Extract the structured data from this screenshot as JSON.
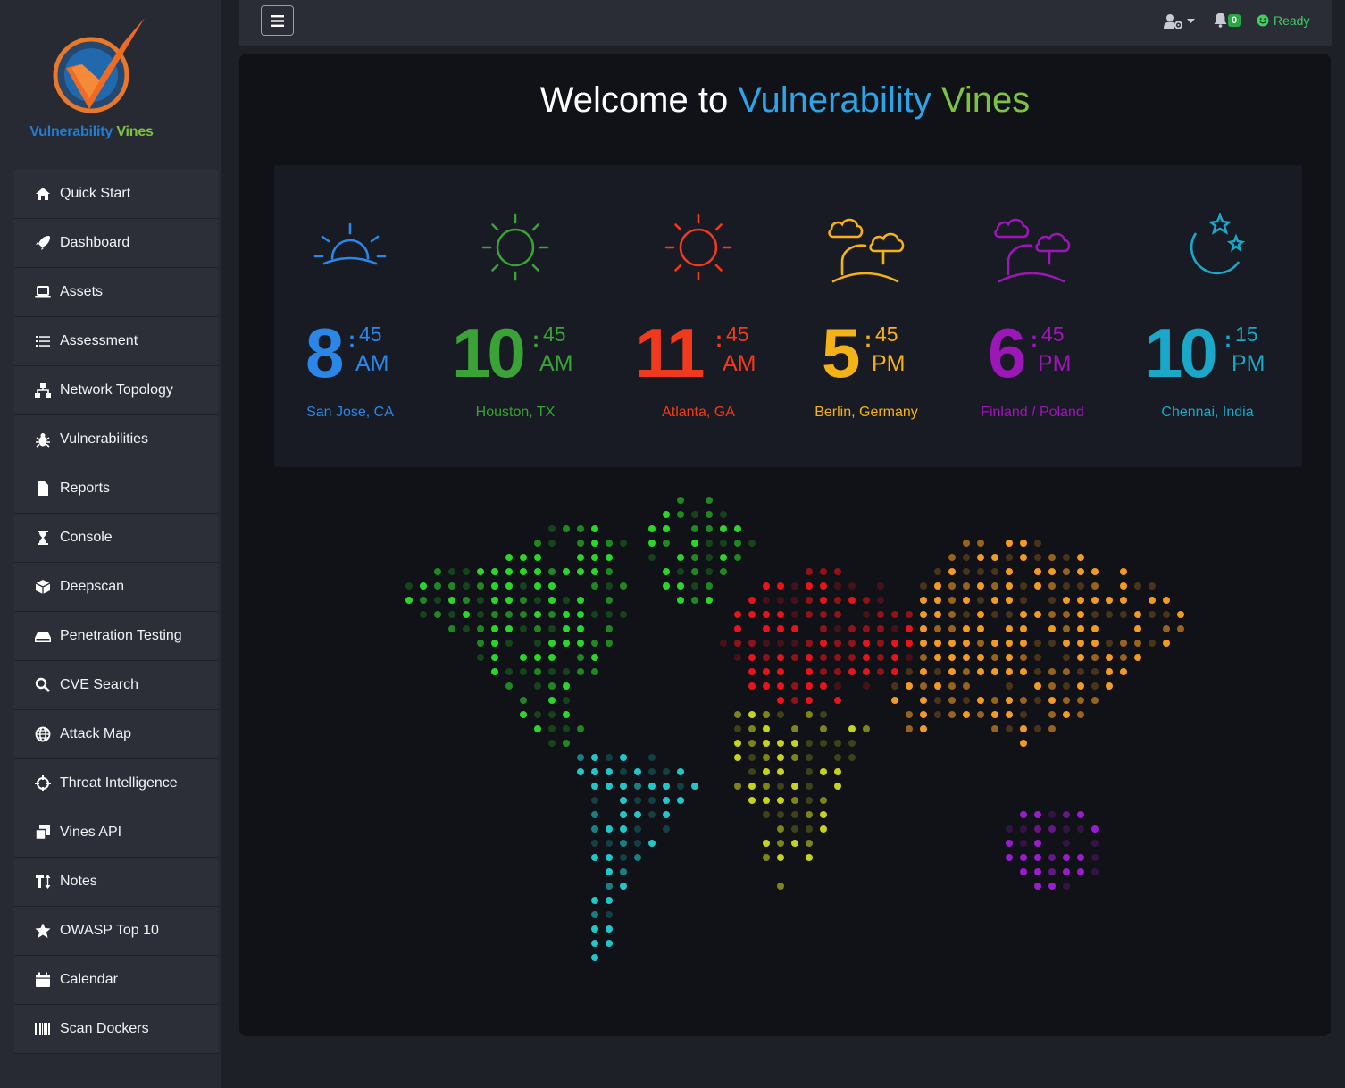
{
  "brand": {
    "name_part1": "Vulnerability",
    "name_part2": "Vines"
  },
  "sidebar": {
    "items": [
      {
        "label": "Quick Start",
        "icon": "home-icon"
      },
      {
        "label": "Dashboard",
        "icon": "rocket-icon"
      },
      {
        "label": "Assets",
        "icon": "laptop-icon"
      },
      {
        "label": "Assessment",
        "icon": "list-icon"
      },
      {
        "label": "Network Topology",
        "icon": "network-icon"
      },
      {
        "label": "Vulnerabilities",
        "icon": "bug-icon"
      },
      {
        "label": "Reports",
        "icon": "file-icon"
      },
      {
        "label": "Console",
        "icon": "hourglass-icon"
      },
      {
        "label": "Deepscan",
        "icon": "cube-icon"
      },
      {
        "label": "Penetration Testing",
        "icon": "hdd-icon"
      },
      {
        "label": "CVE Search",
        "icon": "search-icon"
      },
      {
        "label": "Attack Map",
        "icon": "globe-icon"
      },
      {
        "label": "Threat Intelligence",
        "icon": "crosshairs-icon"
      },
      {
        "label": "Vines API",
        "icon": "clone-icon"
      },
      {
        "label": "Notes",
        "icon": "text-height-icon"
      },
      {
        "label": "OWASP Top 10",
        "icon": "star-icon"
      },
      {
        "label": "Calendar",
        "icon": "calendar-icon"
      },
      {
        "label": "Scan Dockers",
        "icon": "barcode-icon"
      }
    ]
  },
  "topbar": {
    "notification_count": "0",
    "status": "Ready"
  },
  "welcome": {
    "prefix": "Welcome to",
    "part1": "Vulnerability",
    "part2": "Vines"
  },
  "clocks": [
    {
      "hour": "8",
      "minute": "45",
      "ampm": "AM",
      "city": "San Jose, CA",
      "color": "#2a87e8",
      "icon": "sunrise-icon"
    },
    {
      "hour": "10",
      "minute": "45",
      "ampm": "AM",
      "city": "Houston, TX",
      "color": "#3aa236",
      "icon": "sun-icon"
    },
    {
      "hour": "11",
      "minute": "45",
      "ampm": "AM",
      "city": "Atlanta, GA",
      "color": "#f03a1e",
      "icon": "sun-icon"
    },
    {
      "hour": "5",
      "minute": "45",
      "ampm": "PM",
      "city": "Berlin, Germany",
      "color": "#f5b118",
      "icon": "clouds-sunset-icon"
    },
    {
      "hour": "6",
      "minute": "45",
      "ampm": "PM",
      "city": "Finland / Poland",
      "color": "#9c16b8",
      "icon": "clouds-sunset-icon"
    },
    {
      "hour": "10",
      "minute": "15",
      "ampm": "PM",
      "city": "Chennai, India",
      "color": "#1aa7c8",
      "icon": "moon-stars-icon"
    }
  ],
  "map": {
    "colors": {
      "north_america": "#2bd62b",
      "south_america": "#21c6c9",
      "europe": "#e8141c",
      "africa": "#c7d21a",
      "asia": "#f39a22",
      "oceania": "#9b1ccf"
    }
  }
}
